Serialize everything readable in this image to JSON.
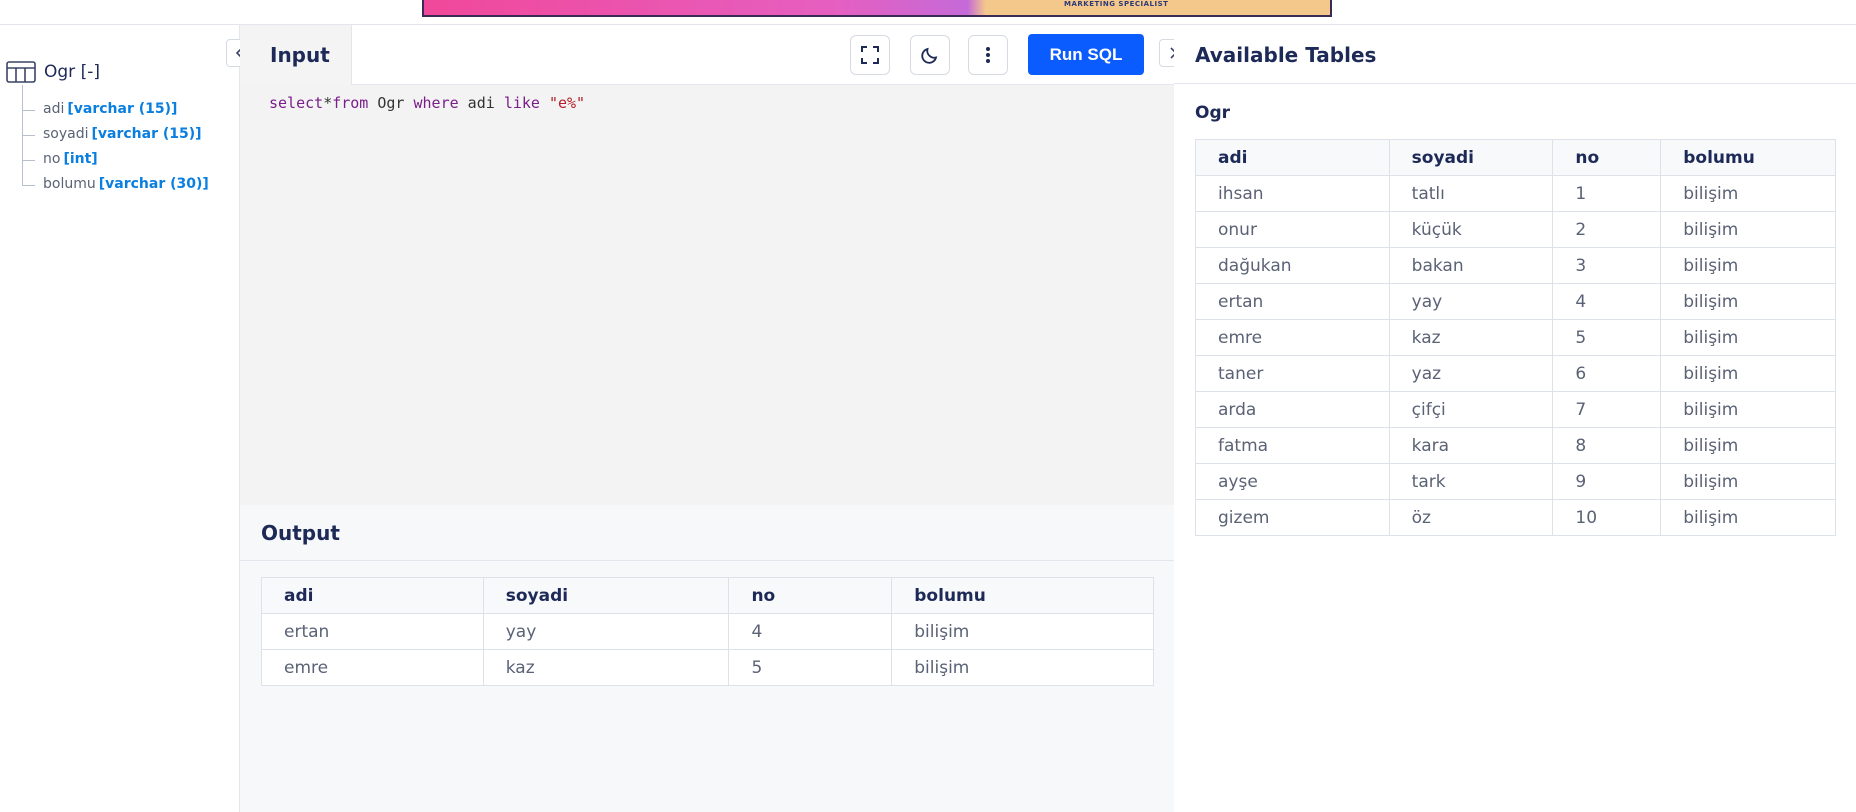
{
  "banner": {
    "ad_text": "MARKETING SPECIALIST"
  },
  "sidebar": {
    "table_label": "Ogr [-]",
    "columns": [
      {
        "name": "adi",
        "type": "[varchar (15)]"
      },
      {
        "name": "soyadi",
        "type": "[varchar (15)]"
      },
      {
        "name": "no",
        "type": "[int]"
      },
      {
        "name": "bolumu",
        "type": "[varchar (30)]"
      }
    ]
  },
  "input": {
    "tab_label": "Input",
    "run_label": "Run SQL",
    "query": {
      "t1": "select",
      "t2": "*",
      "t3": "from",
      "t4": " Ogr ",
      "t5": "where",
      "t6": " adi ",
      "t7": "like",
      "t8": " ",
      "t9": "\"e%\""
    }
  },
  "output": {
    "title": "Output",
    "headers": [
      "adi",
      "soyadi",
      "no",
      "bolumu"
    ],
    "rows": [
      [
        "ertan",
        "yay",
        "4",
        "bilişim"
      ],
      [
        "emre",
        "kaz",
        "5",
        "bilişim"
      ]
    ]
  },
  "available": {
    "title": "Available Tables",
    "table_name": "Ogr",
    "headers": [
      "adi",
      "soyadi",
      "no",
      "bolumu"
    ],
    "rows": [
      [
        "ihsan",
        "tatlı",
        "1",
        "bilişim"
      ],
      [
        "onur",
        "küçük",
        "2",
        "bilişim"
      ],
      [
        "dağukan",
        "bakan",
        "3",
        "bilişim"
      ],
      [
        "ertan",
        "yay",
        "4",
        "bilişim"
      ],
      [
        "emre",
        "kaz",
        "5",
        "bilişim"
      ],
      [
        "taner",
        "yaz",
        "6",
        "bilişim"
      ],
      [
        "arda",
        "çifçi",
        "7",
        "bilişim"
      ],
      [
        "fatma",
        "kara",
        "8",
        "bilişim"
      ],
      [
        "ayşe",
        "tark",
        "9",
        "bilişim"
      ],
      [
        "gizem",
        "öz",
        "10",
        "bilişim"
      ]
    ]
  },
  "colors": {
    "accent": "#0b5cff",
    "type_blue": "#0a7fe0",
    "keyword": "#7a1e8a",
    "string": "#b3202a"
  },
  "icons": {
    "table": "table-icon",
    "collapse_left": "chevron-left-icon",
    "collapse_right": "chevron-right-icon",
    "fullscreen": "fullscreen-icon",
    "theme": "moon-icon",
    "menu": "kebab-menu-icon"
  }
}
